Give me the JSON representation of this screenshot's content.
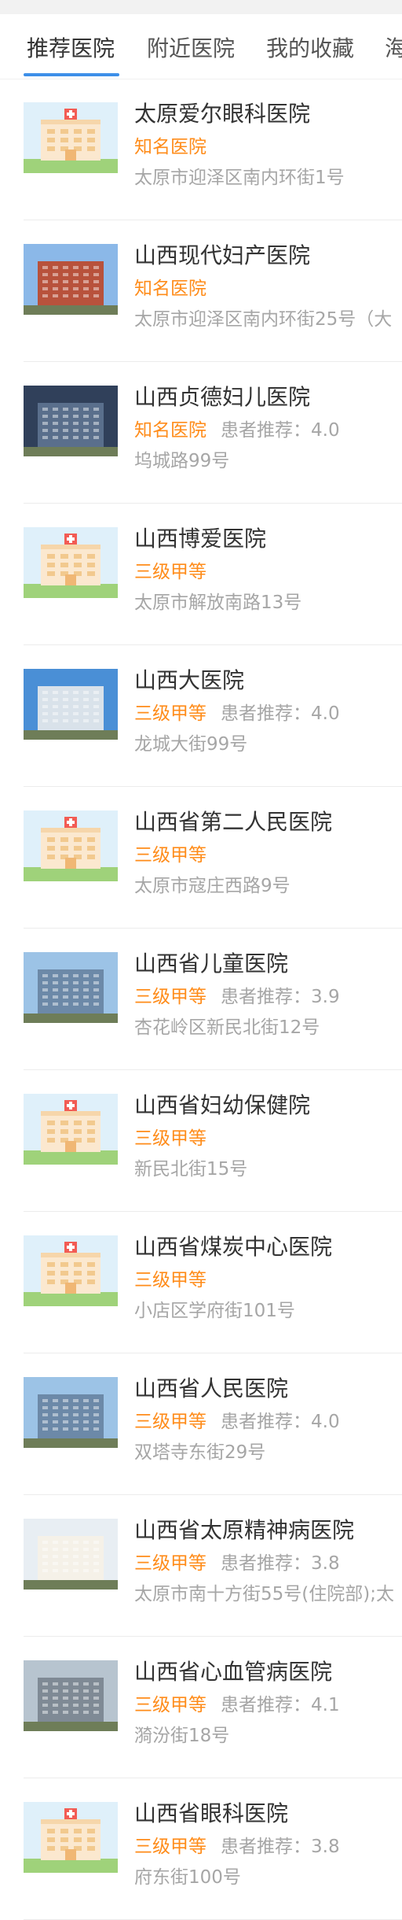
{
  "tabs": [
    "推荐医院",
    "附近医院",
    "我的收藏",
    "海"
  ],
  "rating_label": "患者推荐：",
  "hospitals": [
    {
      "name": "太原爱尔眼科医院",
      "level": "知名医院",
      "rating": "",
      "address": "太原市迎泽区南内环街1号",
      "image": "default-hospital-icon"
    },
    {
      "name": "山西现代妇产医院",
      "level": "知名医院",
      "rating": "",
      "address": "太原市迎泽区南内环街25号（大",
      "image": "hospital-photo-brick"
    },
    {
      "name": "山西贞德妇儿医院",
      "level": "知名医院",
      "rating": "4.0",
      "address": "坞城路99号",
      "image": "hospital-photo-glass"
    },
    {
      "name": "山西博爱医院",
      "level": "三级甲等",
      "rating": "",
      "address": "太原市解放南路13号",
      "image": "default-hospital-icon"
    },
    {
      "name": "山西大医院",
      "level": "三级甲等",
      "rating": "4.0",
      "address": "龙城大街99号",
      "image": "hospital-photo-sky"
    },
    {
      "name": "山西省第二人民医院",
      "level": "三级甲等",
      "rating": "",
      "address": "太原市寇庄西路9号",
      "image": "default-hospital-icon"
    },
    {
      "name": "山西省儿童医院",
      "level": "三级甲等",
      "rating": "3.9",
      "address": "杏花岭区新民北街12号",
      "image": "hospital-photo-tower"
    },
    {
      "name": "山西省妇幼保健院",
      "level": "三级甲等",
      "rating": "",
      "address": "新民北街15号",
      "image": "default-hospital-icon"
    },
    {
      "name": "山西省煤炭中心医院",
      "level": "三级甲等",
      "rating": "",
      "address": "小店区学府街101号",
      "image": "default-hospital-icon"
    },
    {
      "name": "山西省人民医院",
      "level": "三级甲等",
      "rating": "4.0",
      "address": "双塔寺东街29号",
      "image": "hospital-photo-tower"
    },
    {
      "name": "山西省太原精神病医院",
      "level": "三级甲等",
      "rating": "3.8",
      "address": "太原市南十方街55号(住院部);太",
      "image": "hospital-photo-white"
    },
    {
      "name": "山西省心血管病医院",
      "level": "三级甲等",
      "rating": "4.1",
      "address": "漪汾街18号",
      "image": "hospital-photo-grey"
    },
    {
      "name": "山西省眼科医院",
      "level": "三级甲等",
      "rating": "3.8",
      "address": "府东街100号",
      "image": "default-hospital-icon"
    }
  ],
  "colors": {
    "accent": "#3d8fe8",
    "level": "#ff8c1a",
    "muted": "#a6a6a6"
  }
}
